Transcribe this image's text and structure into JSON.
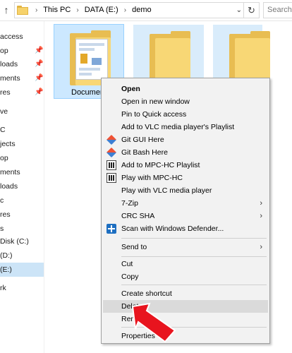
{
  "address_bar": {
    "crumbs": [
      "This PC",
      "DATA (E:)",
      "demo"
    ],
    "search_placeholder": "Search"
  },
  "nav": {
    "items": [
      {
        "label": "access",
        "pinned": false
      },
      {
        "label": "op",
        "pinned": true
      },
      {
        "label": "loads",
        "pinned": true
      },
      {
        "label": "ments",
        "pinned": true
      },
      {
        "label": "res",
        "pinned": true
      },
      {
        "label": "ve",
        "pinned": false
      },
      {
        "label": "C",
        "pinned": false
      },
      {
        "label": "jects",
        "pinned": false
      },
      {
        "label": "op",
        "pinned": false
      },
      {
        "label": "ments",
        "pinned": false
      },
      {
        "label": "loads",
        "pinned": false
      },
      {
        "label": "c",
        "pinned": false
      },
      {
        "label": "res",
        "pinned": false
      },
      {
        "label": "s",
        "pinned": false
      },
      {
        "label": "Disk (C:)",
        "pinned": false
      },
      {
        "label": "(D:)",
        "pinned": false
      },
      {
        "label": "(E:)",
        "pinned": false
      },
      {
        "label": "rk",
        "pinned": false
      }
    ]
  },
  "content": {
    "selected_folder_label": "Documen"
  },
  "context_menu": {
    "items": {
      "open": "Open",
      "open_new_window": "Open in new window",
      "pin_quick_access": "Pin to Quick access",
      "add_vlc_playlist": "Add to VLC media player's Playlist",
      "git_gui": "Git GUI Here",
      "git_bash": "Git Bash Here",
      "add_mpc_playlist": "Add to MPC-HC Playlist",
      "play_mpc": "Play with MPC-HC",
      "play_vlc": "Play with VLC media player",
      "seven_zip": "7-Zip",
      "crc_sha": "CRC SHA",
      "scan_defender": "Scan with Windows Defender...",
      "send_to": "Send to",
      "cut": "Cut",
      "copy": "Copy",
      "create_shortcut": "Create shortcut",
      "delete": "Delete",
      "rename": "Rename",
      "properties": "Properties"
    }
  },
  "colors": {
    "selection_blue": "#cce8ff",
    "menu_bg": "#f2f2f2",
    "highlight": "#dadada",
    "pointer_red": "#e8141e"
  }
}
